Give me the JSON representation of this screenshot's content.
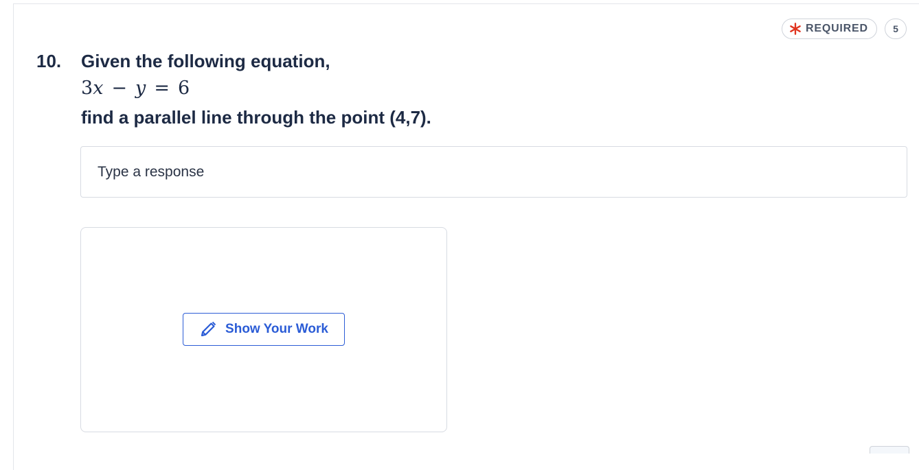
{
  "question": {
    "number": "10.",
    "prompt": "Given the following equation,",
    "equation": {
      "coef": "3",
      "var_x": "x",
      "minus": "−",
      "var_y": "y",
      "equals": "=",
      "rhs": "6"
    },
    "instruction": "find a parallel line through the point (4,7)."
  },
  "badges": {
    "required_label": "REQUIRED",
    "required_icon": "asterisk-icon",
    "points": "5"
  },
  "response": {
    "placeholder": "Type a response",
    "value": ""
  },
  "work_area": {
    "button_label": "Show Your Work",
    "button_icon": "pencil-icon"
  },
  "colors": {
    "text": "#1d2a44",
    "accent": "#2b5cd6",
    "required_star": "#e0341f",
    "border": "#d7dbe2"
  }
}
